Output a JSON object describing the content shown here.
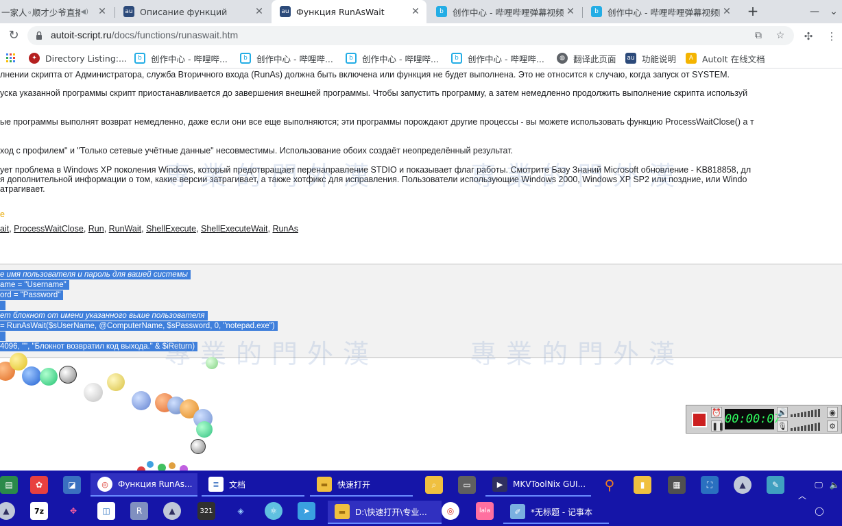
{
  "browser": {
    "tabs": [
      {
        "title": "一家人◦顺才少爷直播",
        "icon": "live-stream-icon",
        "extra": "◀)"
      },
      {
        "title": "Описание функций",
        "icon": "autoit-icon"
      },
      {
        "title": "Функция RunAsWait",
        "icon": "autoit-icon",
        "active": true
      },
      {
        "title": "创作中心 - 哔哩哔哩弹幕视频网",
        "icon": "bilibili-icon"
      },
      {
        "title": "创作中心 - 哔哩哔哩弹幕视频网",
        "icon": "bilibili-icon"
      }
    ],
    "close_glyph": "✕",
    "new_tab_glyph": "+",
    "url_domain": "autoit-script.ru",
    "url_path": "/docs/functions/runaswait.htm",
    "bookmarks": [
      {
        "label": "Directory Listing:...",
        "icon": "red-bird-icon"
      },
      {
        "label": "创作中心 - 哔哩哔...",
        "icon": "bilibili-icon"
      },
      {
        "label": "创作中心 - 哔哩哔...",
        "icon": "bilibili-icon"
      },
      {
        "label": "创作中心 - 哔哩哔...",
        "icon": "bilibili-icon"
      },
      {
        "label": "创作中心 - 哔哩哔...",
        "icon": "bilibili-icon"
      },
      {
        "label": "翻译此页面",
        "icon": "globe-icon"
      },
      {
        "label": "功能说明",
        "icon": "autoit-icon"
      },
      {
        "label": "AutoIt 在线文档",
        "icon": "autoit-yellow-icon"
      }
    ]
  },
  "page": {
    "lines": [
      "лнении скрипта от Администратора, служба Вторичного входа (RunAs) должна быть включена или функция не будет выполнена. Это не относится к случаю, когда запуск от SYSTEM.",
      "уска указанной программы скрипт приостанавливается до завершения внешней программы. Чтобы запустить программу, а затем немедленно продолжить выполнение скрипта используй",
      "ые программы выполнят возврат немедленно, даже если они все еще выполняются; эти программы порождают другие процессы - вы можете использовать функцию ProcessWaitClose() а т",
      "ход с профилем\" и \"Только сетевые учётные данные\" несовместимы. Использование обоих создаёт неопределённый результат.",
      "ует проблема в Windows XP поколения Windows, который предотвращает перенаправление STDIO и показывает флаг работы. Смотрите Базу Знаний Microsoft обновление - KB818858, дл",
      "я дополнительной информации о том, какие версии затрагивает, а также хотфикс для исправления. Пользователи использующие Windows 2000, Windows XP SP2 или поздние, или Windo",
      "атрагивает."
    ],
    "see_also_label": "е",
    "see_also_links": [
      "ait",
      "ProcessWaitClose",
      "Run",
      "RunWait",
      "ShellExecute",
      "ShellExecuteWait",
      "RunAs"
    ],
    "code_lines": [
      {
        "text": "е имя пользователя и пароль для вашей системы",
        "comment": true
      },
      {
        "text": "ame = \"Username\"",
        "comment": false
      },
      {
        "text": "ord = \"Password\"",
        "comment": false
      },
      {
        "text": "",
        "comment": false
      },
      {
        "text": "ет блокнот от имени указанного выше пользователя",
        "comment": true
      },
      {
        "text": "= RunAsWait($sUserName, @ComputerName, $sPassword, 0, \"notepad.exe\")",
        "comment": false
      },
      {
        "text": "",
        "comment": false
      },
      {
        "text": "4096, \"\", \"Блокнот возвратил код выхода.\" & $iReturn)",
        "comment": false
      }
    ],
    "watermark": "專業的門外漢"
  },
  "recorder": {
    "timer": "00:00:07",
    "colors": {
      "stop": "#cc2020",
      "digits": "#30ff60"
    }
  },
  "taskbar": {
    "row1": [
      {
        "label": "Функция RunAs...",
        "icon": "chrome-icon",
        "window": true,
        "active": true
      },
      {
        "label": "文档",
        "icon": "document-icon",
        "window": true
      },
      {
        "label": "快速打开",
        "icon": "folder-icon",
        "window": true
      },
      {
        "label": "MKVToolNix GUI...",
        "icon": "mkvtoolnix-icon",
        "window": true
      }
    ],
    "row2": [
      {
        "label": "D:\\快速打开\\专业...",
        "icon": "folder-icon",
        "window": true
      },
      {
        "label": "*无标题 - 记事本",
        "icon": "notepad-icon",
        "window": true
      }
    ],
    "colors": {
      "background": "#1515a8",
      "accent": "#6a8cff"
    }
  }
}
